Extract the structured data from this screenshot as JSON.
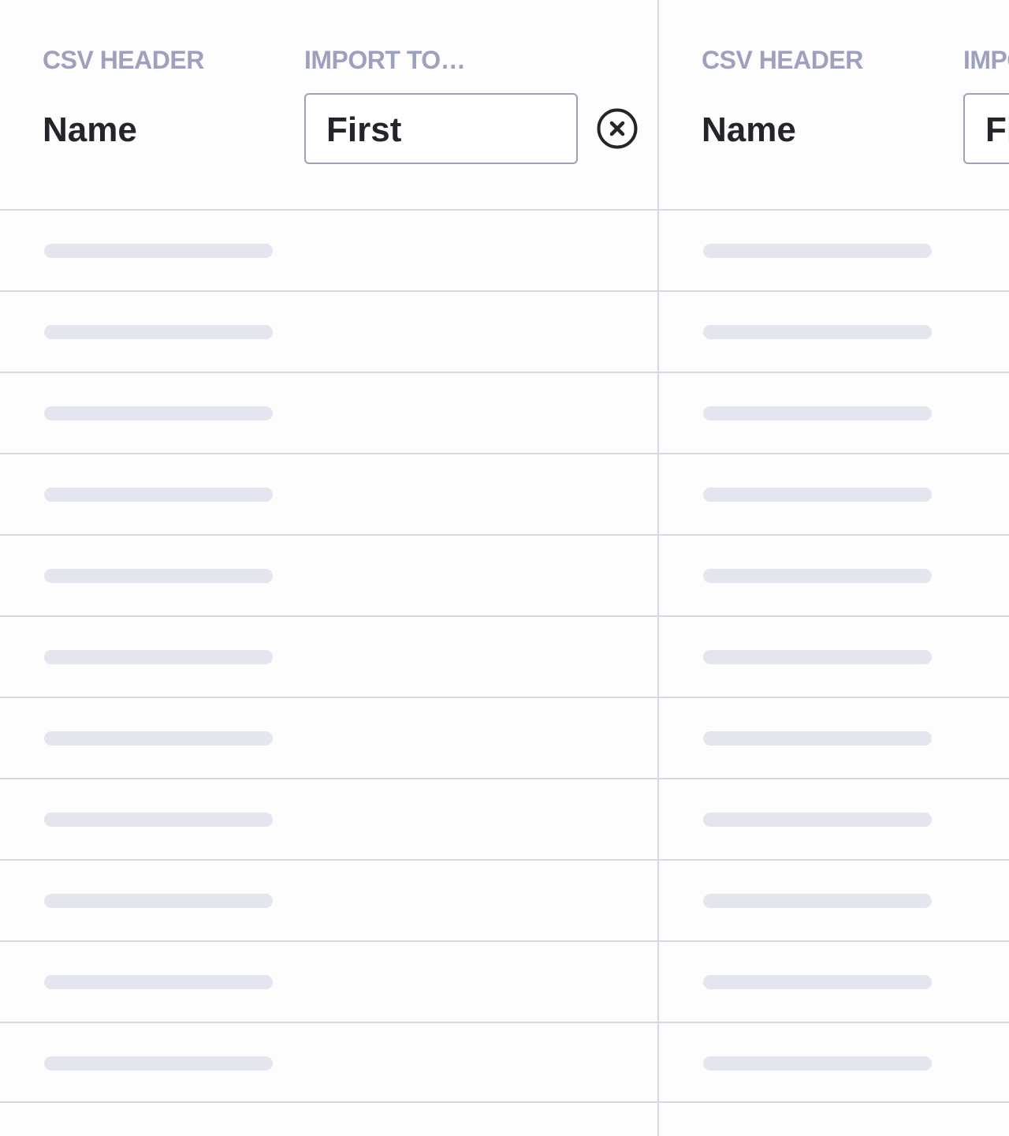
{
  "columns": [
    {
      "csv_header_label": "CSV HEADER",
      "import_to_label": "IMPORT TO…",
      "header_name": "Name",
      "import_to_value": "First"
    },
    {
      "csv_header_label": "CSV HEADER",
      "import_to_label": "IMPORT TO…",
      "header_name": "Name",
      "import_to_value": "First"
    }
  ],
  "icons": {
    "clear": "close-circle-icon"
  },
  "colors": {
    "label": "#9ea1bd",
    "text": "#23252b",
    "border": "#d6d8e4",
    "skeleton": "#e3e6ef"
  },
  "rows_per_column": 11
}
